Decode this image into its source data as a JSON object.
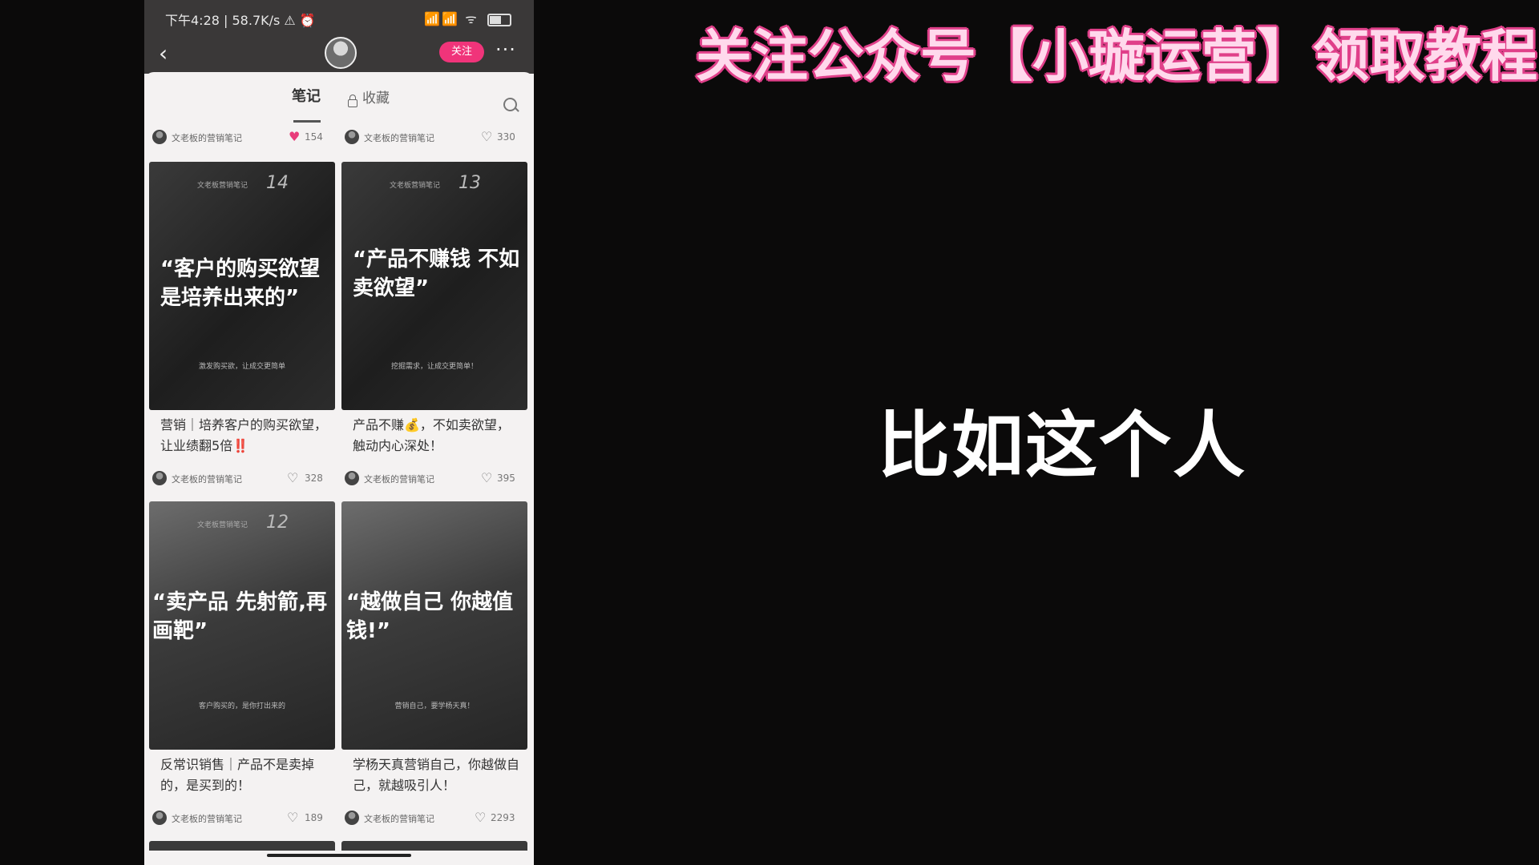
{
  "overlay": {
    "headline": "关注公众号【小璇运营】领取教程",
    "subtitle": "比如这个人"
  },
  "status_bar": {
    "time_speed": "下午4:28 | 58.7K/s ⚠ ⏰",
    "signal": "📶📶 ᯤ"
  },
  "nav": {
    "back": "‹",
    "follow": "关注",
    "more": "···"
  },
  "tabs": {
    "notes": "笔记",
    "favorites": "收藏"
  },
  "top_meta": [
    {
      "author": "文老板的营销笔记",
      "likes": "154",
      "liked": true
    },
    {
      "author": "文老板的营销笔记",
      "likes": "330",
      "liked": false
    }
  ],
  "cards": [
    {
      "number": "14",
      "cover_top": "文老板营销笔记",
      "quote": "“客户的购买欲望是培养出来的”",
      "cover_small": "激发购买欲，让成交更简单",
      "title": "营销｜培养客户的购买欲望，让业绩翻5倍‼️",
      "author": "文老板的营销笔记",
      "likes": "328"
    },
    {
      "number": "13",
      "cover_top": "文老板营销笔记",
      "quote": "“产品不赚钱 不如卖欲望”",
      "cover_small": "挖掘需求，让成交更简单！",
      "title": "产品不赚💰，不如卖欲望，触动内心深处！",
      "author": "文老板的营销笔记",
      "likes": "395"
    },
    {
      "number": "12",
      "cover_top": "文老板营销笔记",
      "quote": "“卖产品 先射箭,再画靶”",
      "cover_small": "客户购买的，是你打出来的",
      "title": "反常识销售｜产品不是卖掉的，是买到的！",
      "author": "文老板的营销笔记",
      "likes": "189"
    },
    {
      "number": "",
      "cover_top": "",
      "quote": "“越做自己 你越值钱!”",
      "cover_small": "营销自己，要学杨天真！",
      "title": "学杨天真营销自己，你越做自己，就越吸引人！",
      "author": "文老板的营销笔记",
      "likes": "2293"
    }
  ]
}
